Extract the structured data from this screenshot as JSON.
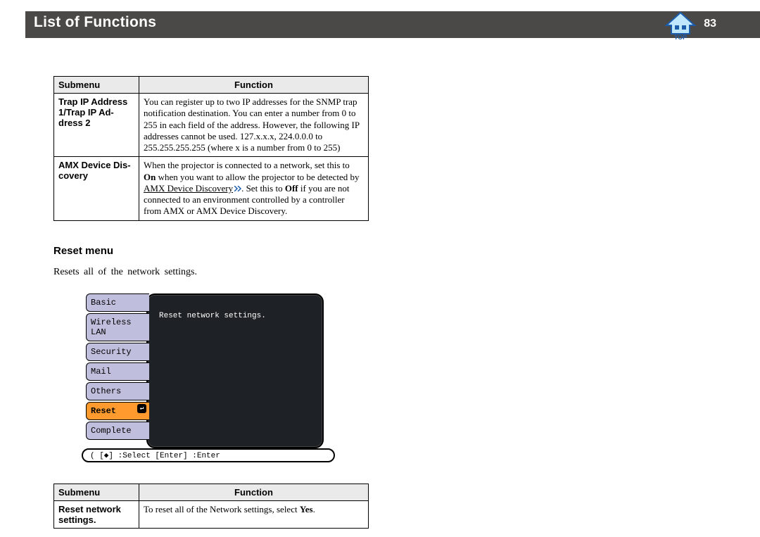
{
  "header": {
    "title": "List of Functions",
    "page_number": "83",
    "icon_name": "top-icon",
    "icon_label": "TOP"
  },
  "table1": {
    "header_submenu": "Submenu",
    "header_function": "Function",
    "rows": [
      {
        "submenu": "Trap IP Address 1/Trap IP Ad-dress 2",
        "fn": "You can register up to two IP addresses for the SNMP trap notification destination. You can enter a number from 0 to 255 in each field of the address. However, the following IP addresses cannot be used. 127.x.x.x, 224.0.0.0 to 255.255.255.255 (where x is a number from 0 to 255)"
      },
      {
        "submenu": "AMX Device Dis-covery",
        "fn_parts": {
          "p1": "When the projector is connected to a network, set this to ",
          "b1": "On",
          "p2": " when you want to allow the projector to be detected by ",
          "link": "AMX Device Discovery",
          "p3": ". Set this to ",
          "b2": "Off",
          "p4": " if you are not connected to an environment controlled by a controller from AMX or AMX Device Discovery."
        }
      }
    ]
  },
  "section": {
    "heading": "Reset  menu",
    "body": "Resets  all  of  the  network  settings."
  },
  "osd": {
    "tabs": [
      "Basic",
      "Wireless LAN",
      "Security",
      "Mail",
      "Others",
      "Reset",
      "Complete"
    ],
    "panel_msg": "Reset network settings.",
    "bar": "( [◆] :Select   [Enter] :Enter"
  },
  "table2": {
    "header_submenu": "Submenu",
    "header_function": "Function",
    "rows": [
      {
        "submenu": "Reset network settings.",
        "fn_pre": "To reset all of the Network settings, select ",
        "fn_bold": "Yes",
        "fn_post": "."
      }
    ]
  }
}
